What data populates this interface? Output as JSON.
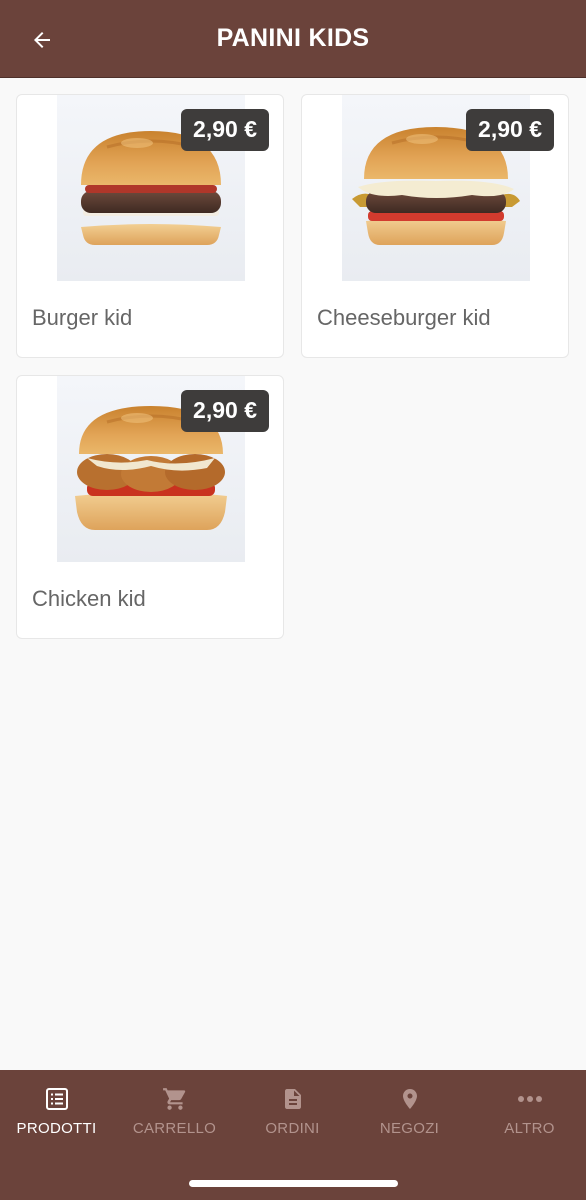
{
  "header": {
    "title": "PANINI KIDS",
    "back_icon": "arrow-left-icon"
  },
  "products": [
    {
      "name": "Burger kid",
      "price": "2,90 €",
      "image": "burger-photo"
    },
    {
      "name": "Cheeseburger kid",
      "price": "2,90 €",
      "image": "cheeseburger-photo"
    },
    {
      "name": "Chicken kid",
      "price": "2,90 €",
      "image": "chicken-burger-photo"
    }
  ],
  "bottom_nav": {
    "items": [
      {
        "label": "PRODOTTI",
        "icon": "list-icon",
        "active": true
      },
      {
        "label": "CARRELLO",
        "icon": "cart-icon",
        "active": false
      },
      {
        "label": "ORDINI",
        "icon": "document-icon",
        "active": false
      },
      {
        "label": "NEGOZI",
        "icon": "location-pin-icon",
        "active": false
      },
      {
        "label": "ALTRO",
        "icon": "more-dots-icon",
        "active": false
      }
    ]
  },
  "colors": {
    "brand": "#6b433b",
    "price_badge": "#3e3c3b",
    "inactive_nav": "#b2938d",
    "background": "#f9f9f9"
  }
}
